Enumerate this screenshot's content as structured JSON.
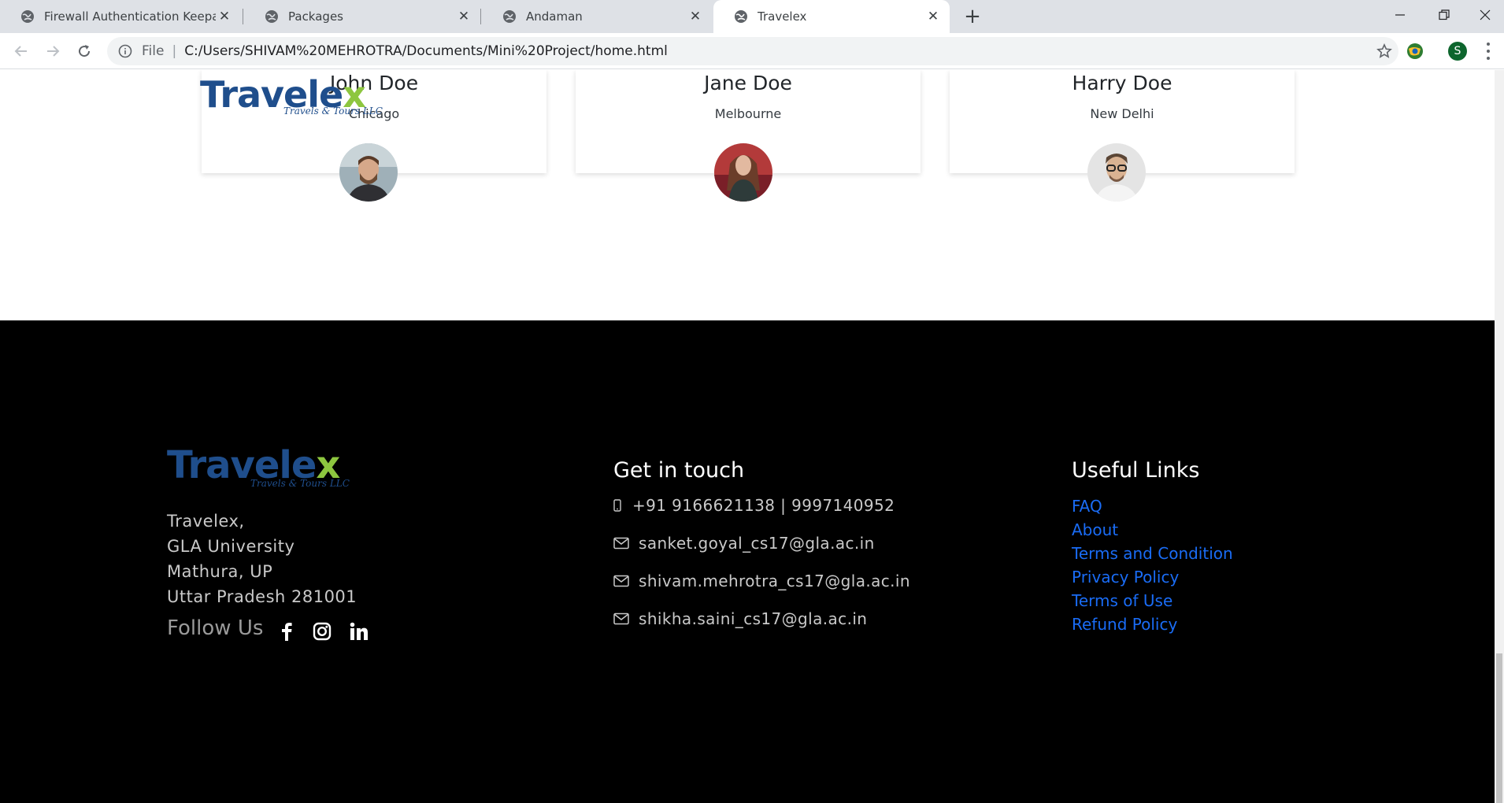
{
  "browser": {
    "tabs": [
      {
        "title": "Firewall Authentication Keepalive"
      },
      {
        "title": "Packages"
      },
      {
        "title": "Andaman"
      },
      {
        "title": "Travelex"
      }
    ],
    "omnibox": {
      "scheme_label": "File",
      "url": "C:/Users/SHIVAM%20MEHROTRA/Documents/Mini%20Project/home.html"
    },
    "profile_initial": "S"
  },
  "testimonials": [
    {
      "name": "John Doe",
      "city": "Chicago"
    },
    {
      "name": "Jane Doe",
      "city": "Melbourne"
    },
    {
      "name": "Harry Doe",
      "city": "New Delhi"
    }
  ],
  "logo": {
    "word": "Travele",
    "x": "x",
    "tagline": "Travels & Tours LLC"
  },
  "footer": {
    "address": [
      "Travelex,",
      "GLA University",
      "Mathura, UP",
      "Uttar Pradesh 281001"
    ],
    "follow_label": "Follow Us",
    "contact_heading": "Get in touch",
    "phone": "+91 9166621138 | 9997140952",
    "emails": [
      "sanket.goyal_cs17@gla.ac.in",
      "shivam.mehrotra_cs17@gla.ac.in",
      "shikha.saini_cs17@gla.ac.in"
    ],
    "links_heading": "Useful Links",
    "links": [
      "FAQ",
      "About",
      "Terms and Condition",
      "Privacy Policy",
      "Terms of Use",
      "Refund Policy"
    ]
  },
  "colors": {
    "link": "#1a6cf5",
    "logo_blue": "#1f4e8c",
    "logo_green": "#8dc63f",
    "footer_bg": "#000000"
  }
}
